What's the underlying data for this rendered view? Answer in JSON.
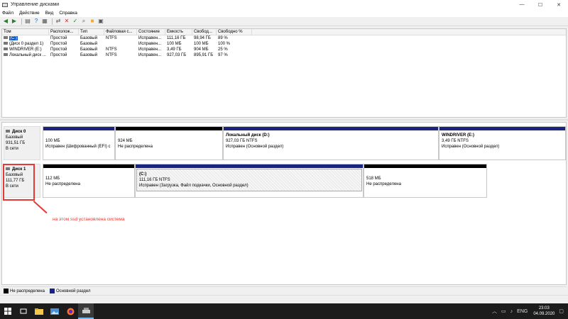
{
  "window": {
    "title": "Управление дисками",
    "controls": {
      "minimize": "—",
      "maximize": "☐",
      "close": "✕"
    }
  },
  "menu": [
    "Файл",
    "Действие",
    "Вид",
    "Справка"
  ],
  "toolbar": [
    "back-icon",
    "forward-icon",
    "properties-icon",
    "help-icon",
    "connect-icon",
    "delete-icon",
    "check-icon",
    "search-icon",
    "new-icon",
    "settings-icon"
  ],
  "volume_table": {
    "columns": [
      "Том",
      "Располож...",
      "Тип",
      "Файловая с...",
      "Состояние",
      "Емкость",
      "Свобод...",
      "Свободно %"
    ],
    "rows": [
      {
        "name": "(C:)",
        "layout": "Простой",
        "type": "Базовый",
        "fs": "NTFS",
        "status": "Исправен...",
        "capacity": "111,16 ГБ",
        "free": "98,94 ГБ",
        "free_pct": "89 %"
      },
      {
        "name": "(Диск 0 раздел 1)",
        "layout": "Простой",
        "type": "Базовый",
        "fs": "",
        "status": "Исправен...",
        "capacity": "100 МБ",
        "free": "100 МБ",
        "free_pct": "100 %"
      },
      {
        "name": "WINDRIVER (E:)",
        "layout": "Простой",
        "type": "Базовый",
        "fs": "NTFS",
        "status": "Исправен...",
        "capacity": "3,49 ГБ",
        "free": "904 МБ",
        "free_pct": "25 %"
      },
      {
        "name": "Локальный диск ...",
        "layout": "Простой",
        "type": "Базовый",
        "fs": "NTFS",
        "status": "Исправен...",
        "capacity": "927,03 ГБ",
        "free": "895,91 ГБ",
        "free_pct": "97 %"
      }
    ]
  },
  "disks": [
    {
      "name": "Диск 0",
      "kind": "Базовый",
      "size": "931,51 ГБ",
      "state": "В сети",
      "partitions": [
        {
          "title": "",
          "size": "100 МБ",
          "status": "Исправен (Шифрованный (EFI) с",
          "bar": "blue"
        },
        {
          "title": "",
          "size": "924 МБ",
          "status": "Не распределена",
          "bar": "black"
        },
        {
          "title": "Локальный диск  (D:)",
          "size": "927,03 ГБ NTFS",
          "status": "Исправен (Основной раздел)",
          "bar": "blue"
        },
        {
          "title": "WINDRIVER  (E:)",
          "size": "3,49 ГБ NTFS",
          "status": "Исправен (Основной раздел)",
          "bar": "blue"
        }
      ]
    },
    {
      "name": "Диск 1",
      "kind": "Базовый",
      "size": "111,77 ГБ",
      "state": "В сети",
      "partitions": [
        {
          "title": "",
          "size": "112 МБ",
          "status": "Не распределена",
          "bar": "black"
        },
        {
          "title": "(C:)",
          "size": "111,16 ГБ NTFS",
          "status": "Исправен (Загрузка, Файл подкачки, Основной раздел)",
          "bar": "blue"
        },
        {
          "title": "",
          "size": "518 МБ",
          "status": "Не распределена",
          "bar": "black"
        }
      ]
    }
  ],
  "annotation": {
    "text": "на этом ssd установлена система",
    "color": "#e53935"
  },
  "legend": [
    {
      "label": "Не распределена",
      "color": "#000000"
    },
    {
      "label": "Основной раздел",
      "color": "#1a237e"
    }
  ],
  "taskbar": {
    "icons": [
      "windows-start-icon",
      "task-view-icon",
      "file-explorer-icon",
      "photos-icon",
      "firefox-icon",
      "disk-management-icon"
    ],
    "tray": {
      "lang": "ENG",
      "time": "23:03",
      "date": "04.09.2020"
    }
  }
}
